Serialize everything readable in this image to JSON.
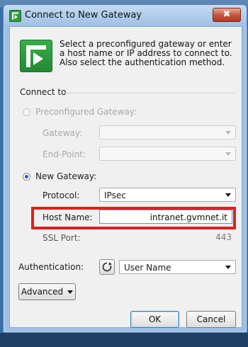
{
  "window": {
    "title": "Connect to New Gateway",
    "close_label": "✖"
  },
  "intro": {
    "text": "Select a preconfigured gateway or enter a host name or IP address to connect to. Also select the authentication method."
  },
  "connect_to": {
    "group_label": "Connect to",
    "preconfigured": {
      "label": "Preconfigured Gateway:",
      "selected": false,
      "gateway_label": "Gateway:",
      "gateway_value": "",
      "endpoint_label": "End-Point:",
      "endpoint_value": ""
    },
    "new_gateway": {
      "label": "New Gateway:",
      "selected": true,
      "protocol_label": "Protocol:",
      "protocol_value": "IPsec",
      "host_label": "Host Name:",
      "host_value": "intranet.gvmnet.it",
      "ssl_label": "SSL Port:",
      "ssl_value": "443"
    }
  },
  "authentication": {
    "label": "Authentication:",
    "value": "User Name"
  },
  "buttons": {
    "advanced": "Advanced",
    "ok": "OK",
    "cancel": "Cancel"
  },
  "colors": {
    "highlight": "#e0201c",
    "brand_green": "#2e9b3e",
    "window_frame": "#9ec0e4"
  }
}
